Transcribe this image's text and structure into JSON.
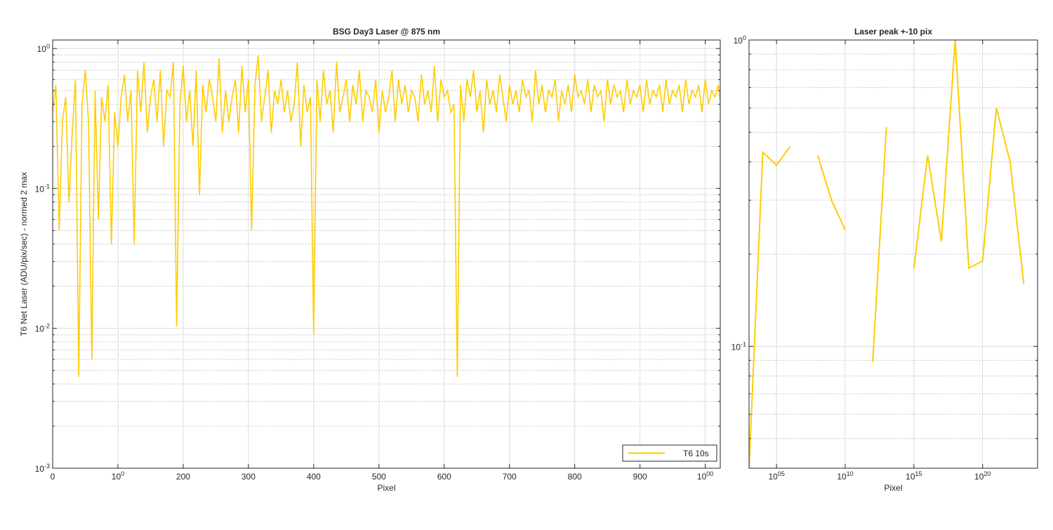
{
  "colors": {
    "line": "#FFCC00",
    "grid": "#cccccc",
    "axis": "#262626"
  },
  "chart_data": [
    {
      "type": "line",
      "title": "BSG  Day3 Laser @ 875 nm",
      "xlabel": "Pixel",
      "ylabel": "T6 Net Laser (ADU/pix/sec) - normed 2 max",
      "xlim": [
        0,
        1023
      ],
      "ylim": [
        0.001,
        1.15
      ],
      "yscale": "log",
      "grid": "on",
      "legend_placement": "bottom-right",
      "xticks": [
        0,
        100,
        200,
        300,
        400,
        500,
        600,
        700,
        800,
        900,
        1000
      ],
      "xtick_labels": [
        "0",
        "100",
        "200",
        "300",
        "400",
        "500",
        "600",
        "700",
        "800",
        "900",
        "1000"
      ],
      "yticks": [
        0.001,
        0.01,
        0.1,
        1
      ],
      "ytick_labels": [
        "10-3",
        "10-2",
        "10-1",
        "100"
      ],
      "series": [
        {
          "name": "T6 10s",
          "x_start": 0,
          "x_step": 5,
          "values": [
            0.35,
            0.55,
            0.05,
            0.3,
            0.45,
            0.08,
            0.25,
            0.6,
            0.0045,
            0.4,
            0.7,
            0.3,
            0.006,
            0.5,
            0.06,
            0.45,
            0.3,
            0.55,
            0.04,
            0.35,
            0.2,
            0.45,
            0.65,
            0.3,
            0.5,
            0.04,
            0.7,
            0.35,
            0.8,
            0.25,
            0.45,
            0.6,
            0.3,
            0.7,
            0.2,
            0.5,
            0.45,
            0.8,
            0.0103,
            0.4,
            0.75,
            0.3,
            0.5,
            0.2,
            0.7,
            0.09,
            0.55,
            0.35,
            0.6,
            0.45,
            0.3,
            0.85,
            0.25,
            0.5,
            0.3,
            0.45,
            0.6,
            0.25,
            0.75,
            0.35,
            0.6,
            0.05,
            0.55,
            0.9,
            0.3,
            0.45,
            0.7,
            0.25,
            0.5,
            0.4,
            0.6,
            0.35,
            0.5,
            0.3,
            0.4,
            0.8,
            0.2,
            0.55,
            0.35,
            0.45,
            0.009,
            0.6,
            0.3,
            0.7,
            0.4,
            0.5,
            0.25,
            0.8,
            0.35,
            0.45,
            0.6,
            0.3,
            0.55,
            0.4,
            0.7,
            0.3,
            0.5,
            0.45,
            0.35,
            0.6,
            0.25,
            0.5,
            0.35,
            0.45,
            0.7,
            0.3,
            0.6,
            0.4,
            0.55,
            0.35,
            0.5,
            0.45,
            0.3,
            0.65,
            0.4,
            0.5,
            0.35,
            0.75,
            0.3,
            0.6,
            0.45,
            0.5,
            0.35,
            0.4,
            0.0045,
            0.55,
            0.3,
            0.6,
            0.45,
            0.7,
            0.35,
            0.5,
            0.25,
            0.6,
            0.4,
            0.5,
            0.35,
            0.65,
            0.45,
            0.3,
            0.55,
            0.4,
            0.5,
            0.35,
            0.6,
            0.45,
            0.5,
            0.3,
            0.7,
            0.4,
            0.55,
            0.35,
            0.5,
            0.45,
            0.6,
            0.3,
            0.5,
            0.4,
            0.55,
            0.35,
            0.65,
            0.45,
            0.5,
            0.4,
            0.6,
            0.35,
            0.55,
            0.45,
            0.5,
            0.3,
            0.6,
            0.4,
            0.55,
            0.45,
            0.5,
            0.35,
            0.6,
            0.4,
            0.5,
            0.45,
            0.55,
            0.35,
            0.6,
            0.4,
            0.5,
            0.45,
            0.55,
            0.35,
            0.6,
            0.4,
            0.5,
            0.45,
            0.55,
            0.35,
            0.6,
            0.4,
            0.5,
            0.45,
            0.55,
            0.35,
            0.6,
            0.4,
            0.5,
            0.45,
            0.55,
            0.35,
            0.6,
            0.4,
            0.5,
            0.45
          ]
        }
      ]
    },
    {
      "type": "line",
      "title": "Laser peak +-10 pix",
      "xlabel": "Pixel",
      "ylabel": "",
      "xlim": [
        1003,
        1024
      ],
      "ylim": [
        0.04,
        1.0
      ],
      "yscale": "log",
      "grid": "on",
      "xticks": [
        1005,
        1010,
        1015,
        1020
      ],
      "xtick_labels": [
        "1005",
        "1010",
        "1015",
        "1020"
      ],
      "yticks": [
        0.1,
        1
      ],
      "ytick_labels": [
        "10-1",
        "100"
      ],
      "segments": [
        {
          "x": [
            1003,
            1004,
            1005,
            1006
          ],
          "y": [
            0.04,
            0.43,
            0.39,
            0.45
          ]
        },
        {
          "x": [
            1008,
            1009,
            1010
          ],
          "y": [
            0.42,
            0.3,
            0.24
          ]
        },
        {
          "x": [
            1012,
            1013
          ],
          "y": [
            0.089,
            0.52
          ]
        },
        {
          "x": [
            1015,
            1016,
            1017,
            1018,
            1019,
            1020,
            1021,
            1022,
            1023
          ],
          "y": [
            0.18,
            0.42,
            0.22,
            1.0,
            0.18,
            0.19,
            0.6,
            0.4,
            0.16
          ]
        }
      ]
    }
  ]
}
